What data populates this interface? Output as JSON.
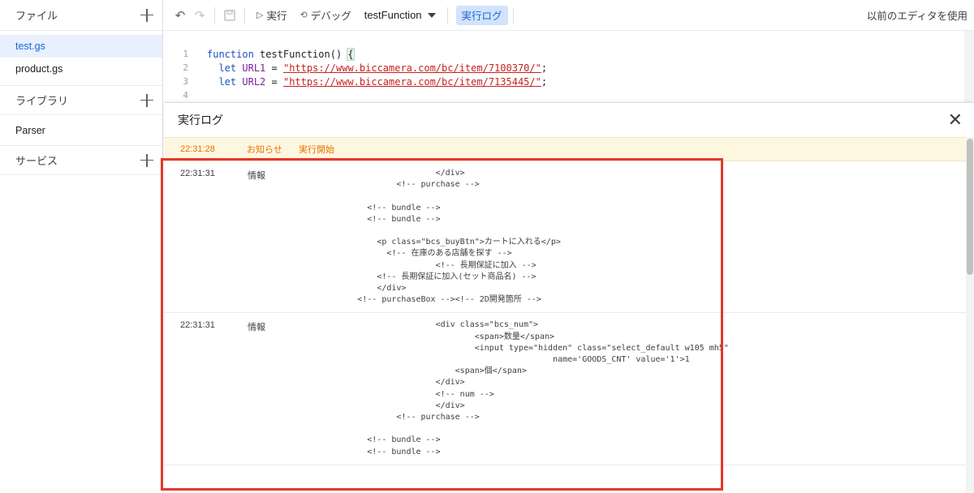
{
  "sidebar": {
    "files_title": "ファイル",
    "files": [
      {
        "label": "test.gs"
      },
      {
        "label": "product.gs"
      }
    ],
    "libraries_title": "ライブラリ",
    "libraries": [
      {
        "label": "Parser"
      }
    ],
    "services_title": "サービス"
  },
  "toolbar": {
    "undo_icon": "undo-icon",
    "redo_icon": "redo-icon",
    "save_icon": "save-icon",
    "run_label": "実行",
    "debug_label": "デバッグ",
    "function_name": "testFunction",
    "log_label": "実行ログ",
    "legacy_editor": "以前のエディタを使用"
  },
  "code": {
    "lines": [
      {
        "num": "1",
        "text": "function testFunction() {"
      },
      {
        "num": "2",
        "kw": "let",
        "name": "URL1",
        "eq": " = ",
        "str": "\"https://www.biccamera.com/bc/item/7100370/\"",
        "end": ";"
      },
      {
        "num": "3",
        "kw": "let",
        "name": "URL2",
        "eq": " = ",
        "str": "\"https://www.biccamera.com/bc/item/7135445/\"",
        "end": ";"
      },
      {
        "num": "4",
        "text": ""
      }
    ]
  },
  "log": {
    "title": "実行ログ",
    "notice": {
      "time": "22:31:28",
      "level": "お知らせ",
      "message": "実行開始"
    },
    "entries": [
      {
        "time": "22:31:31",
        "level": "情報",
        "message": "                            </div>\n                    <!-- purchase -->\n\n              <!-- bundle -->\n              <!-- bundle -->\n\n                <p class=\"bcs_buyBtn\">カートに入れる</p>\n                  <!-- 在庫のある店舗を探す -->\n                            <!-- 長期保証に加入 -->\n                <!-- 長期保証に加入(セット商品名) -->\n                </div>\n            <!-- purchaseBox --><!-- 2D開発箇所 -->"
      },
      {
        "time": "22:31:31",
        "level": "情報",
        "message": "                            <div class=\"bcs_num\">\n                                    <span>数量</span>\n                                    <input type=\"hidden\" class=\"select_default w105 mh5\"\n                                                    name='GOODS_CNT' value='1'>1\n                                <span>個</span>\n                            </div>\n                            <!-- num -->\n                            </div>\n                    <!-- purchase -->\n\n              <!-- bundle -->\n              <!-- bundle -->"
      }
    ]
  }
}
